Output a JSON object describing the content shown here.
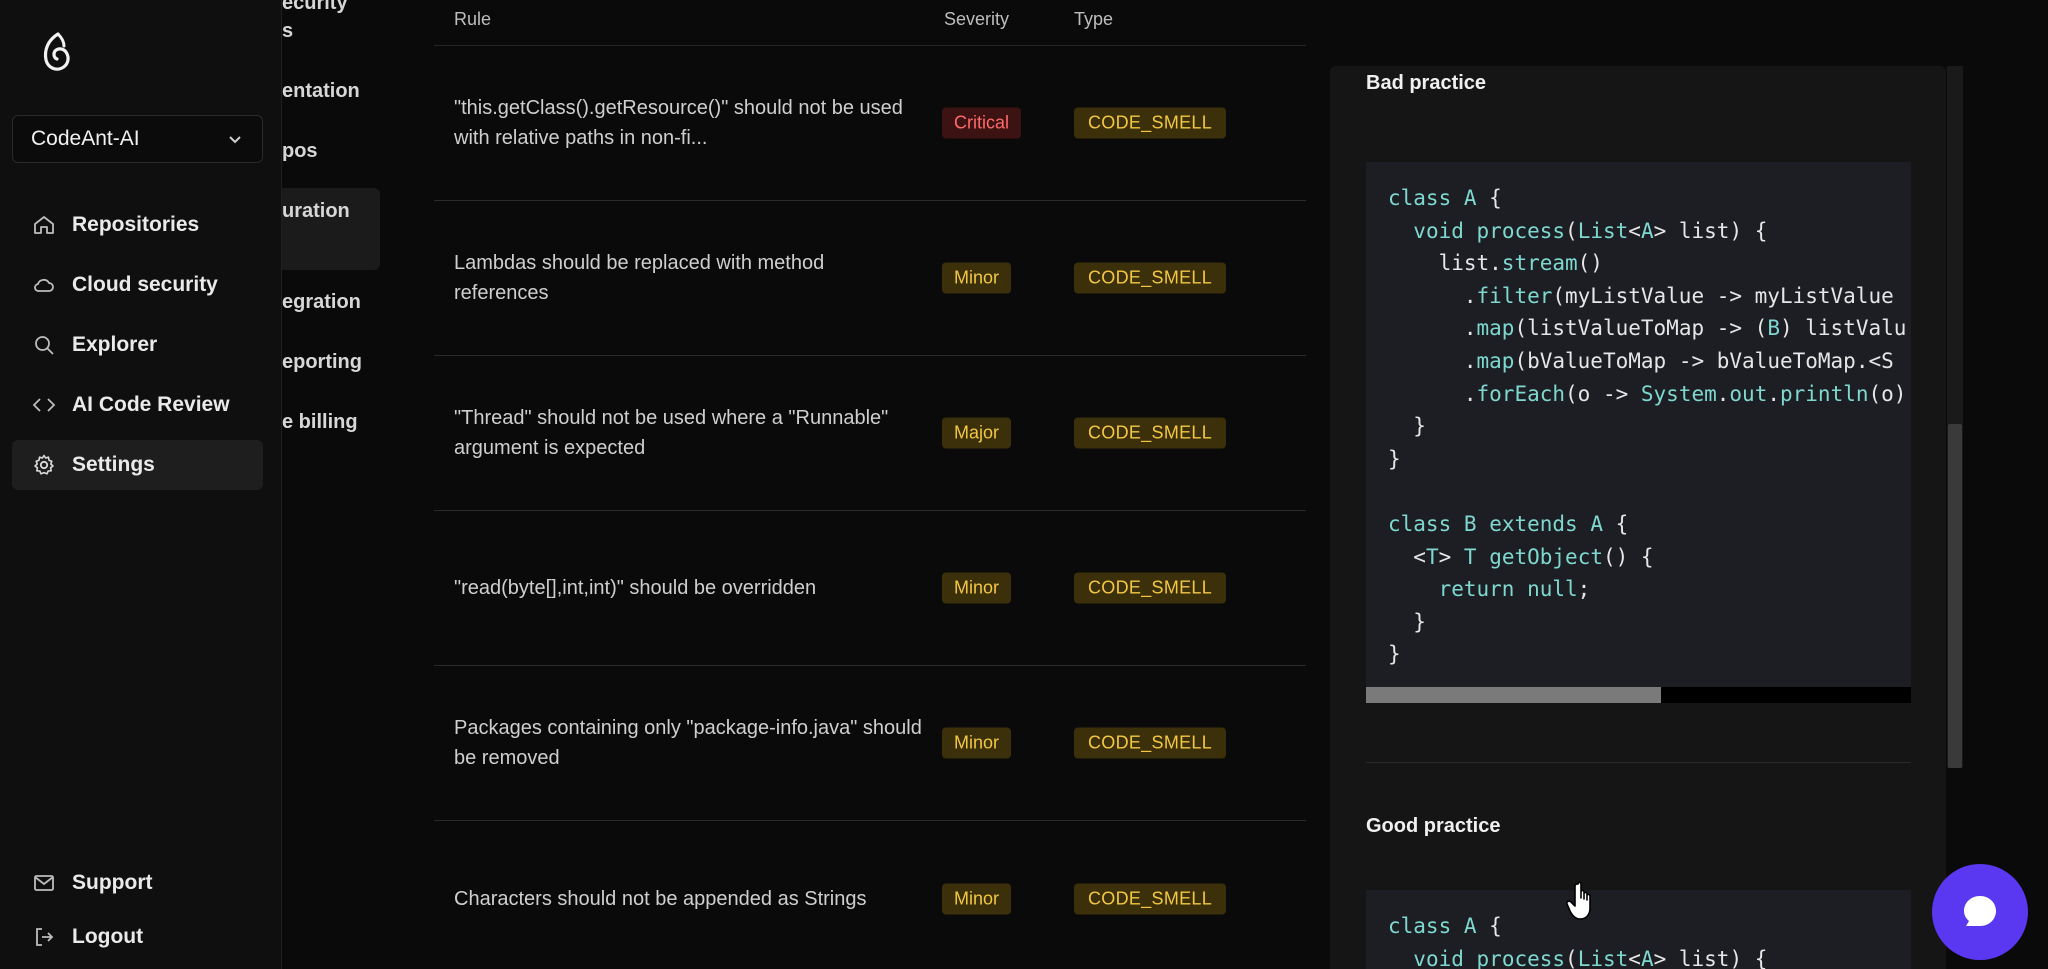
{
  "sidebar": {
    "org": "CodeAnt-AI",
    "items": [
      {
        "label": "Repositories",
        "icon": "home-icon"
      },
      {
        "label": "Cloud security",
        "icon": "cloud-icon"
      },
      {
        "label": "Explorer",
        "icon": "search-icon"
      },
      {
        "label": "AI Code Review",
        "icon": "code-icon"
      },
      {
        "label": "Settings",
        "icon": "gear-icon",
        "active": true
      }
    ],
    "bottom": [
      {
        "label": "Support",
        "icon": "mail-icon"
      },
      {
        "label": "Logout",
        "icon": "logout-icon"
      }
    ]
  },
  "submenu": {
    "items": [
      "ecurity",
      "s",
      "entation",
      "pos",
      "uration",
      "egration",
      "eporting",
      "e billing"
    ]
  },
  "table": {
    "headers": {
      "rule": "Rule",
      "severity": "Severity",
      "type": "Type"
    },
    "rows": [
      {
        "rule": "\"this.getClass().getResource()\" should not be used with relative paths in non-fi...",
        "severity": "Critical",
        "type": "CODE_SMELL"
      },
      {
        "rule": "Lambdas should be replaced with method references",
        "severity": "Minor",
        "type": "CODE_SMELL"
      },
      {
        "rule": "\"Thread\" should not be used where a \"Runnable\" argument is expected",
        "severity": "Major",
        "type": "CODE_SMELL"
      },
      {
        "rule": "\"read(byte[],int,int)\" should be overridden",
        "severity": "Minor",
        "type": "CODE_SMELL"
      },
      {
        "rule": "Packages containing only \"package-info.java\" should be removed",
        "severity": "Minor",
        "type": "CODE_SMELL"
      },
      {
        "rule": "Characters should not be appended as Strings",
        "severity": "Minor",
        "type": "CODE_SMELL"
      }
    ]
  },
  "panel": {
    "bad_title": "Bad practice",
    "bad_code": [
      "class A {",
      "  void process(List<A> list) {",
      "    list.stream()",
      "      .filter(myListValue -> myListValue",
      "      .map(listValueToMap -> (B) listValu",
      "      .map(bValueToMap -> bValueToMap.<S",
      "      .forEach(o -> System.out.println(o)",
      "  }",
      "}",
      "",
      "class B extends A {",
      "  <T> T getObject() {",
      "    return null;",
      "  }",
      "}"
    ],
    "good_title": "Good practice",
    "good_code": [
      "class A {",
      "  void process(List<A> list) {"
    ]
  },
  "colors": {
    "accent": "#5a37f0",
    "critical": "#ff6b6b",
    "warning": "#f3c744",
    "code_keyword": "#7fd8cf"
  }
}
